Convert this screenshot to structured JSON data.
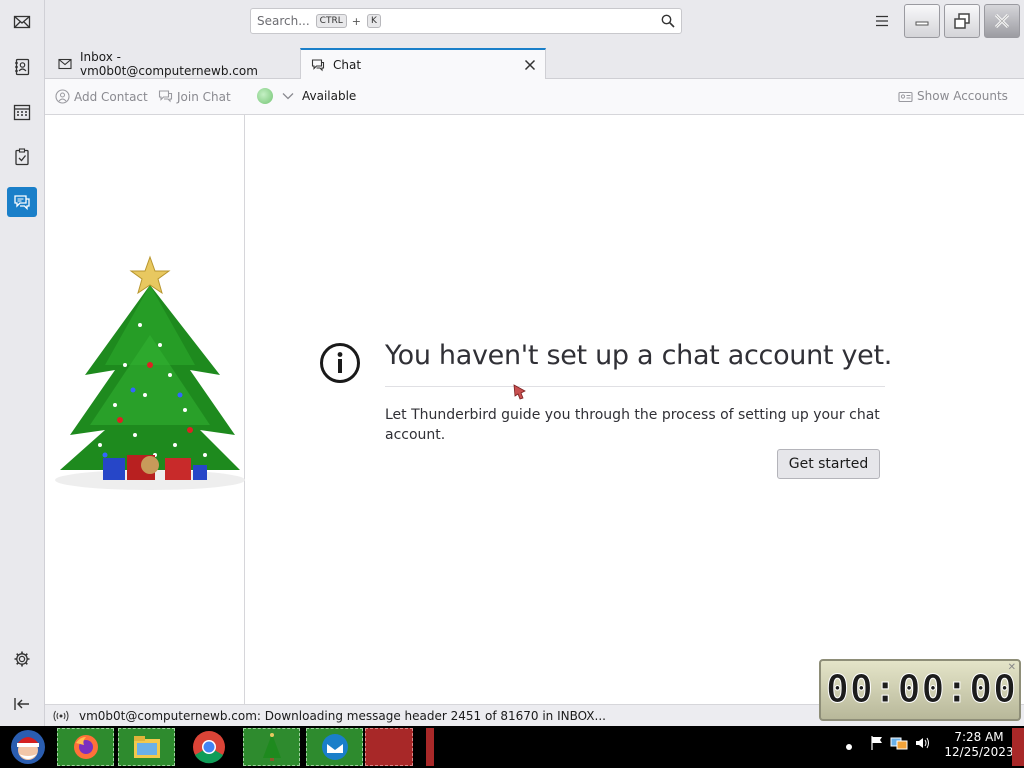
{
  "search": {
    "placeholder": "Search...",
    "shortcut_key1": "CTRL",
    "shortcut_plus": "+",
    "shortcut_key2": "K"
  },
  "tabs": [
    {
      "label": "Inbox - vm0b0t@computernewb.com",
      "icon": "mail-icon"
    },
    {
      "label": "Chat",
      "icon": "chat-icon",
      "active": true
    }
  ],
  "chat_toolbar": {
    "add_contact": "Add Contact",
    "join_chat": "Join Chat",
    "status": "Available",
    "show_accounts": "Show Accounts"
  },
  "main": {
    "heading": "You haven't set up a chat account yet.",
    "description": "Let Thunderbird guide you through the process of setting up your chat account.",
    "button": "Get started"
  },
  "statusbar": {
    "message": "vm0b0t@computernewb.com: Downloading message header 2451 of 81670 in INBOX..."
  },
  "timer": {
    "value": "00:00:00"
  },
  "taskbar": {
    "time": "7:28 AM",
    "date": "12/25/2023"
  },
  "colors": {
    "accent": "#1a7fc9",
    "status_available": "#74c474"
  }
}
